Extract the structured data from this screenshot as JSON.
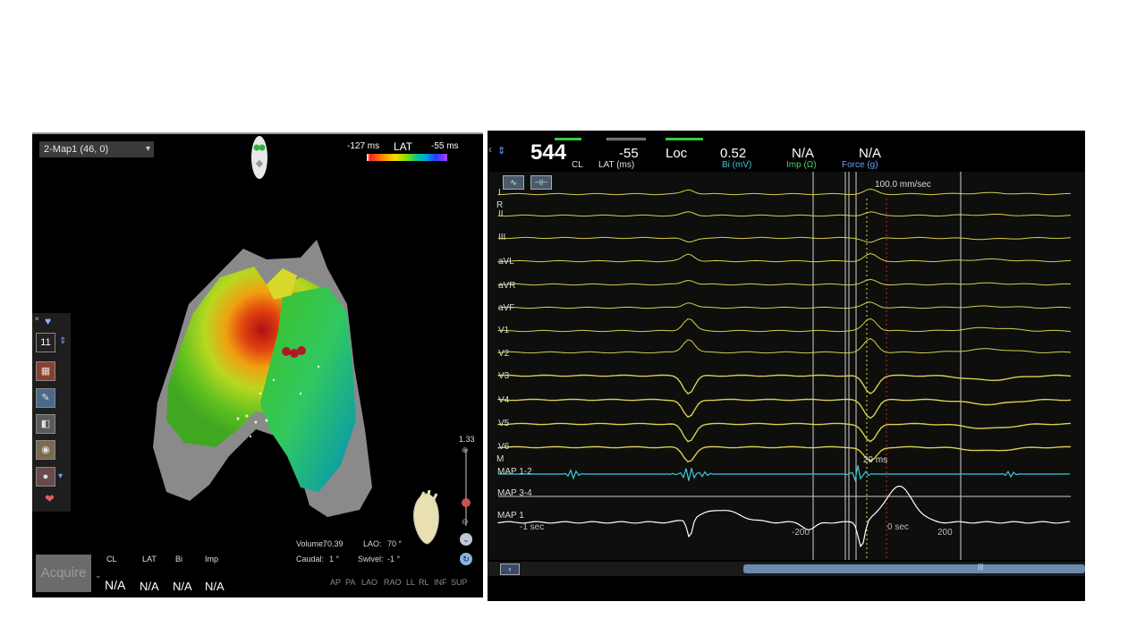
{
  "map": {
    "title": "2-Map1 (46, 0)",
    "lat_scale": {
      "min": "-127 ms",
      "title": "LAT",
      "max": "-55 ms"
    },
    "toolbar": {
      "counter": "11"
    },
    "acquire_label": "Acquire",
    "headers": [
      "CL",
      "LAT",
      "Bi",
      "Imp"
    ],
    "values": [
      "N/A",
      "N/A",
      "N/A",
      "N/A"
    ],
    "zoom_value": "1.33",
    "stats": {
      "volume_label": "Volume:",
      "volume_value": "70.39",
      "lao_label": "LAO:",
      "lao_value": "70 °",
      "caudal_label": "Caudal:",
      "caudal_value": "1 °",
      "swivel_label": "Swivel:",
      "swivel_value": "-1 °"
    },
    "view_buttons": [
      "AP",
      "PA",
      "LAO",
      "RAO",
      "LL",
      "RL",
      "INF",
      "SUP"
    ]
  },
  "egm": {
    "readouts": [
      {
        "value": "544",
        "label": "CL",
        "label_color": "#e0e0e0"
      },
      {
        "value": "-55",
        "label": "LAT (ms)",
        "label_color": "#e0e0e0"
      },
      {
        "value": "Loc",
        "label": "",
        "label_color": "#e0e0e0"
      },
      {
        "value": "0.52",
        "label": "Bi (mV)",
        "label_color": "#3cc8d8"
      },
      {
        "value": "N/A",
        "label": "Imp (Ω)",
        "label_color": "#4cd060"
      },
      {
        "value": "N/A",
        "label": "Force (g)",
        "label_color": "#6aa0ff"
      }
    ],
    "sweep_speed": "100.0 mm/sec",
    "leads": [
      "I",
      "R",
      "II",
      "III",
      "aVL",
      "aVR",
      "aVF",
      "V1",
      "V2",
      "V3",
      "V4",
      "V5",
      "V6",
      "M",
      "MAP 1-2",
      "MAP 3-4",
      "MAP 1"
    ],
    "annotation_ms": "29 ms",
    "time_labels": {
      "left": "-1 sec",
      "minus200": "-200",
      "zero": "0 sec",
      "plus200": "200"
    },
    "colors": {
      "ecg": "#d8d050",
      "map12": "#3cc8d8",
      "map1": "#ffffff"
    }
  }
}
